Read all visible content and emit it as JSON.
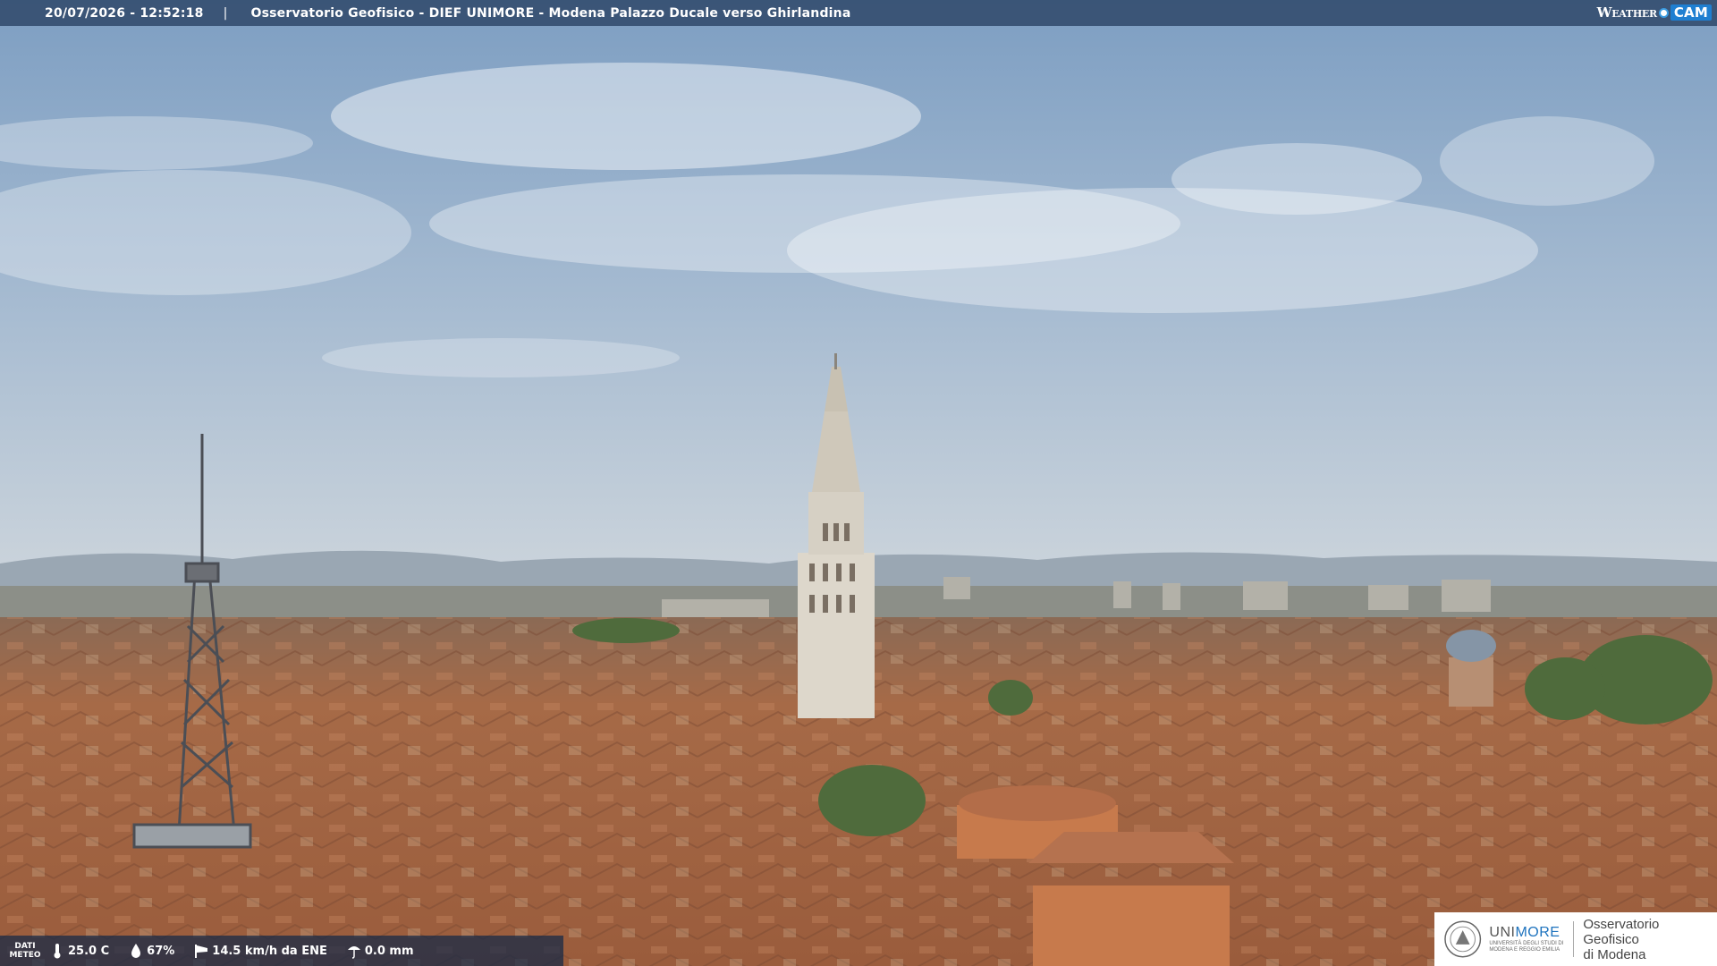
{
  "header": {
    "datetime": "20/07/2026 - 12:52:18",
    "separator": "|",
    "camera_title": "Osservatorio Geofisico - DIEF UNIMORE - Modena Palazzo Ducale verso Ghirlandina",
    "brand_weather": "Weather",
    "brand_cam": "CAM"
  },
  "meteo": {
    "label_line1": "DATI",
    "label_line2": "METEO",
    "temperature": "25.0 C",
    "humidity": "67%",
    "wind": "14.5 km/h da ENE",
    "rain": "0.0 mm"
  },
  "logo": {
    "uni_prefix": "UNI",
    "uni_suffix": "MORE",
    "uni_sub": "UNIVERSITÀ DEGLI STUDI DI MODENA E REGGIO EMILIA",
    "obs_line1": "Osservatorio Geofisico",
    "obs_line2": "di Modena"
  },
  "colors": {
    "sky_top": "#7f9fc2",
    "sky_bottom": "#c9d3dc",
    "roofs": "#a0674a",
    "tower": "#d9d3c8"
  },
  "icons": {
    "temperature": "thermometer-icon",
    "humidity": "droplet-icon",
    "wind": "windsock-icon",
    "rain": "rain-icon"
  }
}
